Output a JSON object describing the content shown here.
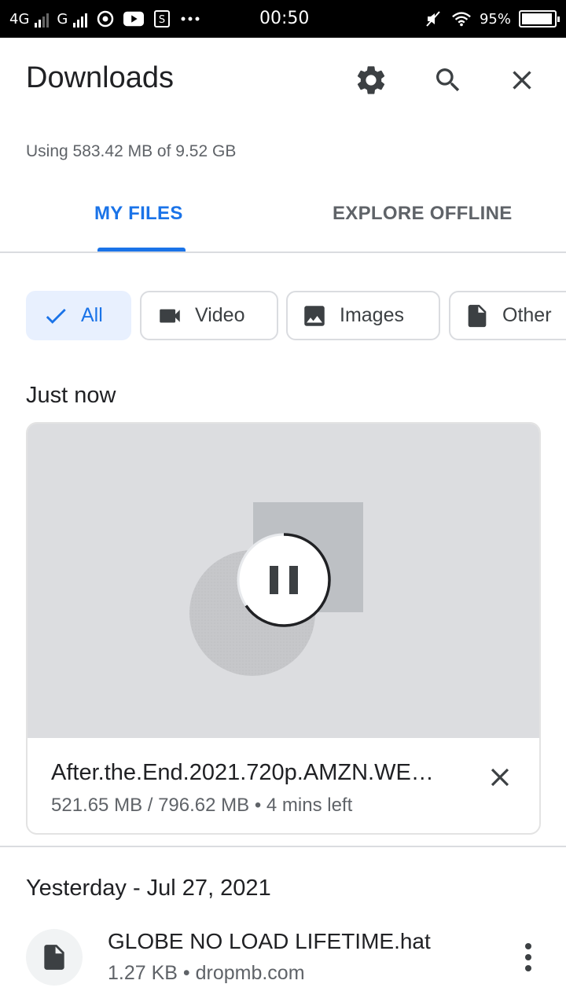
{
  "status_bar": {
    "network1": "4G",
    "network2": "G",
    "time": "00:50",
    "battery": "95%",
    "battery_level": 0.95
  },
  "header": {
    "title": "Downloads",
    "usage": "Using 583.42 MB of 9.52 GB"
  },
  "tabs": [
    {
      "label": "MY FILES",
      "selected": true
    },
    {
      "label": "EXPLORE OFFLINE",
      "selected": false
    }
  ],
  "filters": [
    {
      "label": "All",
      "icon": "check-icon",
      "selected": true
    },
    {
      "label": "Video",
      "icon": "video-icon",
      "selected": false
    },
    {
      "label": "Images",
      "icon": "image-icon",
      "selected": false
    },
    {
      "label": "Other",
      "icon": "document-icon",
      "selected": false
    }
  ],
  "sections": {
    "recent_label": "Just now",
    "older_label": "Yesterday - Jul 27, 2021"
  },
  "active_download": {
    "filename": "After.the.End.2021.720p.AMZN.WE…",
    "progress_text": "521.65 MB / 796.62 MB • 4 mins left",
    "progress": 0.655,
    "state_icon": "pause-icon"
  },
  "files": [
    {
      "name": "GLOBE NO LOAD LIFETIME.hat",
      "meta": "1.27 KB • dropmb.com",
      "icon": "document-icon"
    }
  ],
  "colors": {
    "accent": "#1a73e8",
    "chip_selected_bg": "#e8f0fe",
    "thumb_bg": "#dcdde0",
    "text_secondary": "#5f6368"
  }
}
